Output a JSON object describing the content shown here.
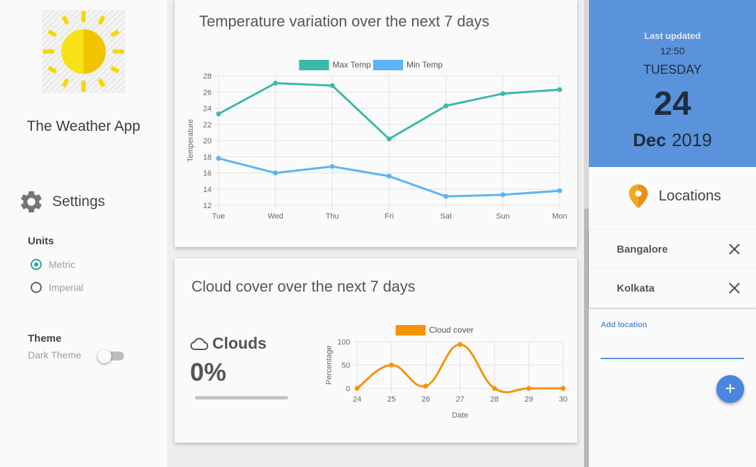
{
  "app": {
    "title": "The Weather App"
  },
  "settings": {
    "title": "Settings",
    "units": {
      "label": "Units",
      "options": [
        "Metric",
        "Imperial"
      ],
      "selected": "Metric"
    },
    "theme": {
      "label": "Theme",
      "dark_label": "Dark Theme",
      "dark_enabled": false
    }
  },
  "temp_card": {
    "title": "Temperature variation over the next 7 days"
  },
  "cloud_card": {
    "title": "Cloud cover over the next 7 days",
    "clouds_label": "Clouds",
    "clouds_value": "0%",
    "clouds_fraction": 0
  },
  "date_panel": {
    "last_updated_label": "Last updated",
    "time": "12:50",
    "day": "TUESDAY",
    "date": "24",
    "month": "Dec",
    "year": "2019"
  },
  "locations": {
    "title": "Locations",
    "items": [
      "Bangalore",
      "Kolkata"
    ],
    "add_label": "Add location",
    "add_value": ""
  },
  "colors": {
    "max_temp": "#3cb8aa",
    "min_temp": "#5ab4f3",
    "cloud": "#f5930a",
    "accent": "#5b92dc",
    "radio": "#26a69a"
  },
  "icons": [
    "sun-logo-icon",
    "gear-icon",
    "cloud-icon",
    "map-pin-icon",
    "close-icon",
    "plus-icon"
  ],
  "chart_data": [
    {
      "type": "line",
      "title": "",
      "categories": [
        "Tue",
        "Wed",
        "Thu",
        "Fri",
        "Sat",
        "Sun",
        "Mon"
      ],
      "series": [
        {
          "name": "Max Temp",
          "values": [
            23.3,
            27.1,
            26.8,
            20.2,
            24.3,
            25.8,
            26.3
          ]
        },
        {
          "name": "Min Temp",
          "values": [
            17.8,
            16.0,
            16.8,
            15.6,
            13.1,
            13.3,
            13.8
          ]
        }
      ],
      "xlabel": "",
      "ylabel": "Temperature",
      "ylim": [
        12,
        28
      ],
      "yticks": [
        12,
        14,
        16,
        18,
        20,
        22,
        24,
        26,
        28
      ],
      "grid": true,
      "legend": "top"
    },
    {
      "type": "line",
      "title": "",
      "x": [
        "24",
        "25",
        "26",
        "27",
        "28",
        "29",
        "30"
      ],
      "series": [
        {
          "name": "Cloud cover",
          "values": [
            0,
            50,
            5,
            94,
            0,
            0,
            0
          ]
        }
      ],
      "xlabel": "Date",
      "ylabel": "Percentage",
      "ylim": [
        0,
        100
      ],
      "yticks": [
        0,
        50,
        100
      ],
      "grid": true,
      "legend": "top",
      "smooth": true
    }
  ]
}
